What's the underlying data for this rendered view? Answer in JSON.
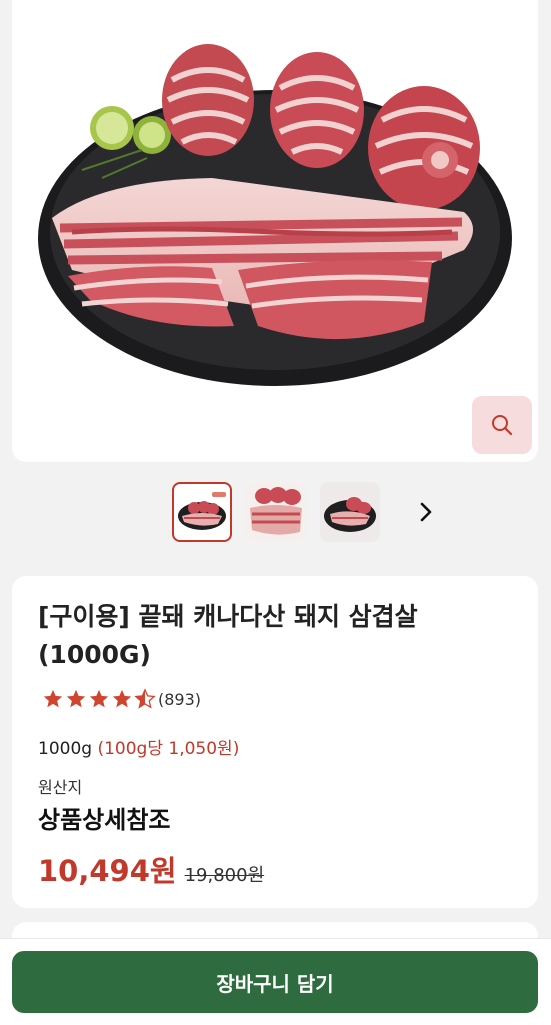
{
  "product": {
    "title": "[구이용] 끝돼 캐나다산 돼지 삼겹살 (1000G)",
    "rating": 4.5,
    "review_count": "(893)",
    "weight": "1000g",
    "unit_price": "(100g당 1,050원)",
    "origin_label": "원산지",
    "origin_value": "상품상세참조",
    "sale_price": "10,494원",
    "original_price": "19,800원"
  },
  "gallery": {
    "zoom_icon": "search-icon",
    "next_icon": "chevron-right-icon",
    "thumbnail_count": 3,
    "active_index": 0
  },
  "cart": {
    "label": "장바구니 담기"
  },
  "colors": {
    "accent": "#c0392b",
    "cart_button": "#2e6b3f",
    "zoom_bg": "#f6dcdc",
    "star": "#d0452f"
  }
}
